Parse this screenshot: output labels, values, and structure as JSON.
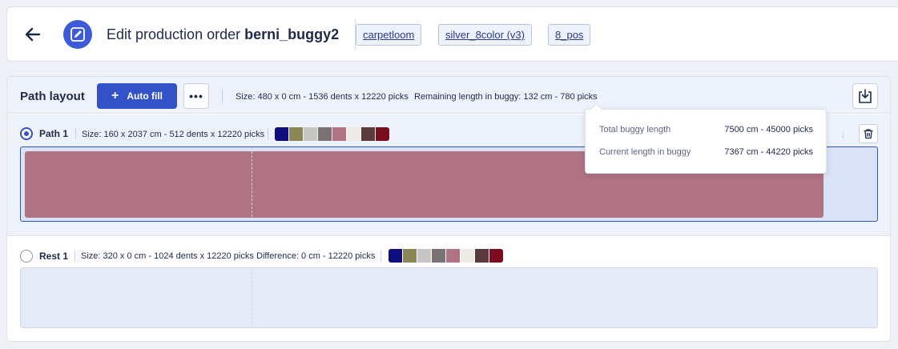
{
  "header": {
    "title_prefix": "Edit production order",
    "title_name": "berni_buggy2",
    "tags": [
      "carpetloom",
      "silver_8color (v3)",
      "8_pos"
    ]
  },
  "toolbar": {
    "section_title": "Path layout",
    "autofill_label": "Auto fill",
    "more_label": "•••",
    "size_text": "Size: 480 x 0 cm - 1536 dents x 12220 picks",
    "remaining_text": "Remaining length in buggy: 132 cm - 780 picks"
  },
  "tooltip": {
    "rows": [
      {
        "label": "Total buggy length",
        "value": "7500 cm - 45000 picks"
      },
      {
        "label": "Current length in buggy",
        "value": "7367 cm - 44220 picks"
      }
    ]
  },
  "path": {
    "label": "Path 1",
    "size_text": "Size: 160 x 2037 cm - 512 dents x 12220 picks",
    "selected": true,
    "bar_color": "#b07383",
    "fill_fraction": 0.94
  },
  "rest": {
    "label": "Rest 1",
    "size_text": "Size: 320 x 0 cm - 1024 dents x 12220 picks",
    "difference_text": "Difference: 0 cm - 12220 picks",
    "selected": false
  },
  "palette": [
    "#0e0e7c",
    "#8b8558",
    "#c6c7c2",
    "#7a7174",
    "#b07383",
    "#eeebe7",
    "#5a3a3d",
    "#7b0e1e"
  ],
  "colors": {
    "accent": "#3352c7",
    "badge": "#3d5bd9",
    "tag_text": "#2a3a8c"
  }
}
